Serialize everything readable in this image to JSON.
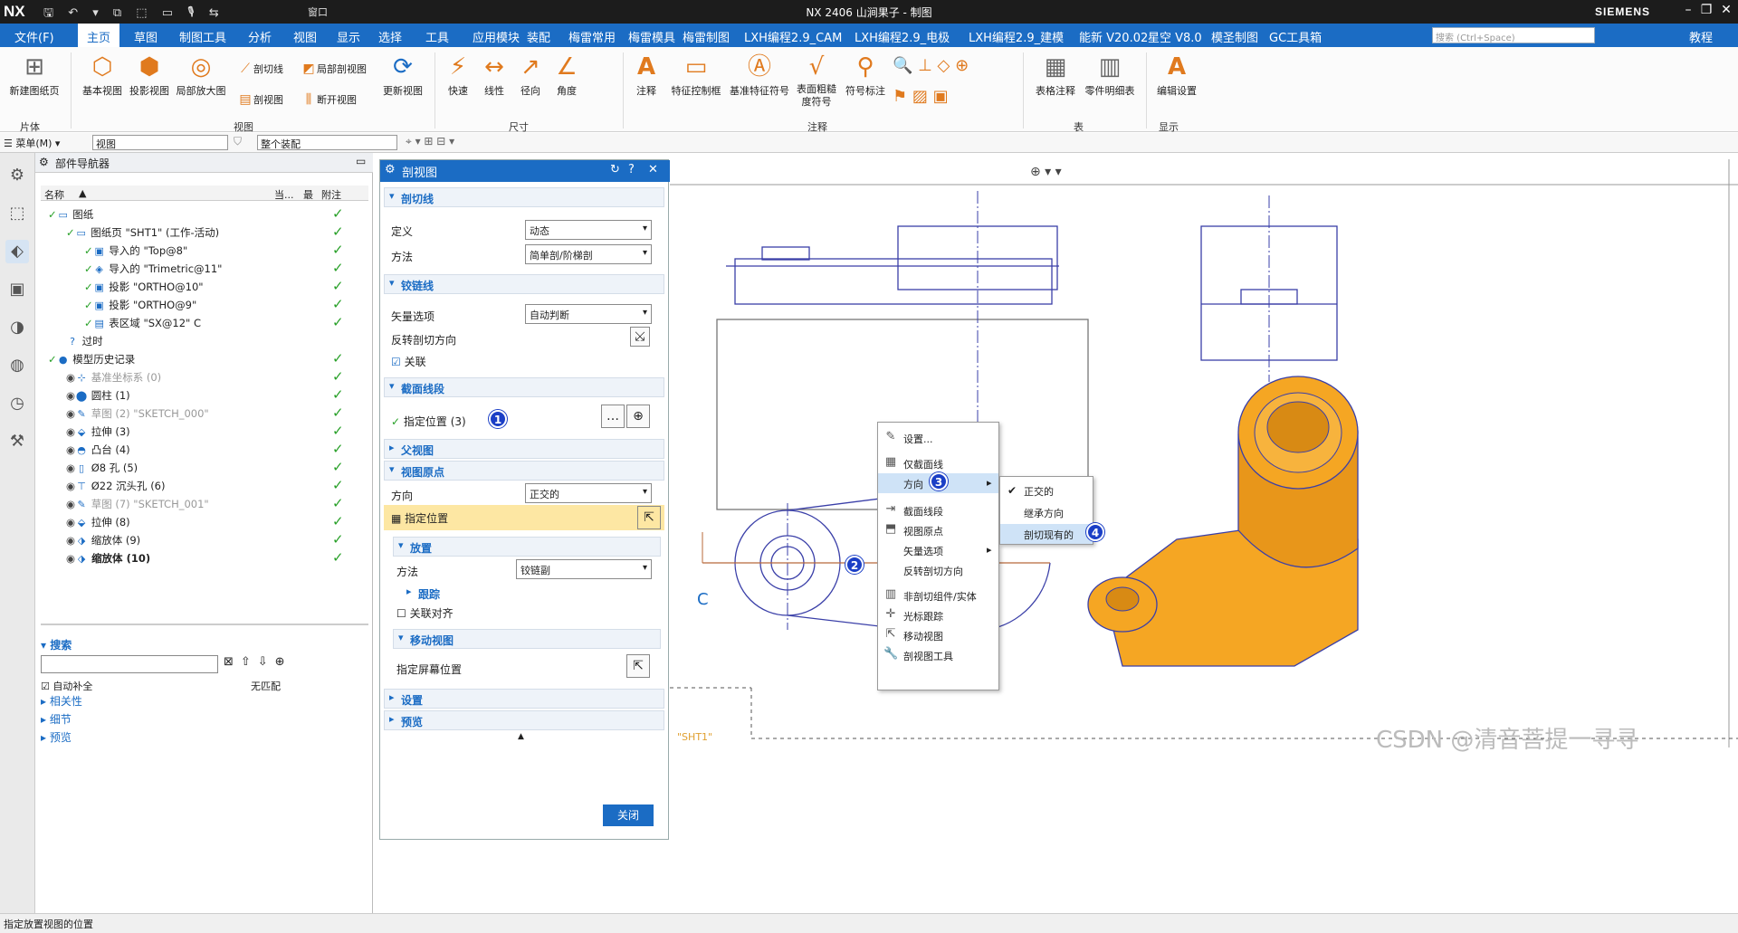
{
  "titlebar": {
    "logo": "NX",
    "title": "NX 2406 山涧果子 - 制图",
    "brand": "SIEMENS",
    "window_label": "窗口"
  },
  "menu": {
    "items": [
      "文件(F)",
      "主页",
      "草图",
      "制图工具",
      "分析",
      "视图",
      "显示",
      "选择",
      "工具",
      "应用模块",
      "装配",
      "梅雷常用",
      "梅雷模具",
      "梅雷制图",
      "LXH编程2.9_CAM",
      "LXH编程2.9_电极",
      "LXH编程2.9_建模",
      "能新 V20.02",
      "星空 V8.0",
      "模圣制图",
      "GC工具箱"
    ],
    "active": "主页",
    "search_placeholder": "搜索 (Ctrl+Space)",
    "tutorial": "教程"
  },
  "ribbon": {
    "new_sheet": "新建图纸页",
    "base_view": "基本视图",
    "proj_view": "投影视图",
    "detail_view": "局部放大图",
    "section_line": "剖切线",
    "partial_section": "局部剖视图",
    "section_view": "剖视图",
    "break_view": "断开视图",
    "update_view": "更新视图",
    "rapid": "快速",
    "linear": "线性",
    "radial": "径向",
    "angle": "角度",
    "note": "注释",
    "fcf": "特征控制框",
    "datum_symbol": "基准特征符号",
    "surface_finish": "表面粗糙度符号",
    "symbol_label": "符号标注",
    "table_note": "表格注释",
    "parts_list": "零件明细表",
    "edit_settings": "编辑设置",
    "groups": {
      "sheet": "片体",
      "view": "视图",
      "dim": "尺寸",
      "annot": "注释",
      "table": "表",
      "display": "显示"
    }
  },
  "toolbar2": {
    "menu": "菜单(M)",
    "filter": "视图",
    "scope": "整个装配"
  },
  "navigator": {
    "title": "部件导航器",
    "col_name": "名称",
    "col_current": "当...",
    "col_latest": "最",
    "col_note": "附注",
    "rows": [
      {
        "label": "图纸",
        "check": "✓"
      },
      {
        "label": "图纸页 \"SHT1\" (工作-活动)",
        "check": "✓"
      },
      {
        "label": "导入的 \"Top@8\"",
        "check": "✓"
      },
      {
        "label": "导入的 \"Trimetric@11\"",
        "check": "✓"
      },
      {
        "label": "投影 \"ORTHO@10\"",
        "check": "✓"
      },
      {
        "label": "投影 \"ORTHO@9\"",
        "check": "✓"
      },
      {
        "label": "表区域 \"SX@12\" C",
        "check": "✓"
      },
      {
        "label": "过时",
        "check": ""
      },
      {
        "label": "模型历史记录",
        "check": "✓"
      },
      {
        "label": "基准坐标系 (0)",
        "check": "✓"
      },
      {
        "label": "圆柱 (1)",
        "check": "✓"
      },
      {
        "label": "草图 (2) \"SKETCH_000\"",
        "check": "✓"
      },
      {
        "label": "拉伸 (3)",
        "check": "✓"
      },
      {
        "label": "凸台 (4)",
        "check": "✓"
      },
      {
        "label": "Ø8 孔 (5)",
        "check": "✓"
      },
      {
        "label": "Ø22 沉头孔 (6)",
        "check": "✓"
      },
      {
        "label": "草图 (7) \"SKETCH_001\"",
        "check": "✓"
      },
      {
        "label": "拉伸 (8)",
        "check": "✓"
      },
      {
        "label": "缩放体 (9)",
        "check": "✓"
      },
      {
        "label": "缩放体 (10)",
        "check": "✓"
      }
    ],
    "search_label": "搜索",
    "auto_complete": "自动补全",
    "no_match": "无匹配",
    "dependencies": "相关性",
    "details": "细节",
    "preview": "预览"
  },
  "dialog": {
    "title": "剖视图",
    "sec_section_line": "剖切线",
    "definition_label": "定义",
    "definition_value": "动态",
    "method_label": "方法",
    "method_value": "简单剖/阶梯剖",
    "sec_hinge": "铰链线",
    "vector_label": "矢量选项",
    "vector_value": "自动判断",
    "reverse_label": "反转剖切方向",
    "assoc_label": "关联",
    "sec_segment": "截面线段",
    "specify_loc": "指定位置 (3)",
    "sec_parent": "父视图",
    "sec_origin": "视图原点",
    "direction_label": "方向",
    "direction_value": "正交的",
    "specify_pos": "指定位置",
    "sec_placement": "放置",
    "place_method_label": "方法",
    "place_method_value": "铰链副",
    "sec_track": "跟踪",
    "assoc_align": "关联对齐",
    "sec_move": "移动视图",
    "screen_pos": "指定屏幕位置",
    "sec_settings": "设置",
    "sec_preview": "预览",
    "close": "关闭"
  },
  "context_menu": {
    "items": [
      "设置...",
      "仅截面线",
      "方向",
      "截面线段",
      "视图原点",
      "矢量选项",
      "反转剖切方向",
      "非剖切组件/实体",
      "光标跟踪",
      "移动视图",
      "剖视图工具"
    ],
    "submenu": [
      "正交的",
      "继承方向",
      "剖切现有的"
    ]
  },
  "badges": [
    "1",
    "2",
    "3",
    "4"
  ],
  "canvas": {
    "sheet_label": "\"SHT1\"",
    "section_letter": "C"
  },
  "status": {
    "text": "指定放置视图的位置",
    "watermark": "CSDN @清音菩提一寻寻"
  },
  "colors": {
    "accent": "#1b6cc4",
    "model": "#f5a623",
    "check": "#28a028",
    "badge": "#1b3fc6"
  }
}
